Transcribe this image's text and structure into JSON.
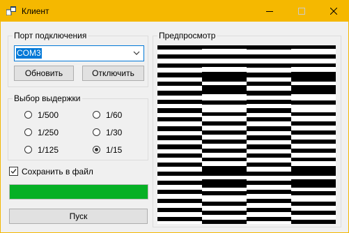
{
  "window": {
    "title": "Клиент",
    "colors": {
      "title_bar": "#f5b800",
      "client_bg": "#f0f0f0",
      "accent": "#0078d7",
      "progress": "#06b025"
    },
    "controls": {
      "minimize_icon": "minimize-icon",
      "maximize_icon": "maximize-icon",
      "close_icon": "close-icon"
    }
  },
  "port_group": {
    "title": "Порт подключения",
    "port_value": "COM3",
    "refresh_label": "Обновить",
    "disconnect_label": "Отключить"
  },
  "exposure_group": {
    "title": "Выбор выдержки",
    "options": [
      {
        "label": "1/500",
        "checked": false
      },
      {
        "label": "1/60",
        "checked": false
      },
      {
        "label": "1/250",
        "checked": false
      },
      {
        "label": "1/30",
        "checked": false
      },
      {
        "label": "1/125",
        "checked": false
      },
      {
        "label": "1/15",
        "checked": true
      }
    ]
  },
  "save_to_file": {
    "label": "Сохранить в файл",
    "checked": true
  },
  "progress": {
    "value_fraction": 1.0
  },
  "start_label": "Пуск",
  "preview": {
    "title": "Предпросмотр",
    "pattern_colors": {
      "dark": "#000000",
      "light": "#ffffff"
    }
  }
}
